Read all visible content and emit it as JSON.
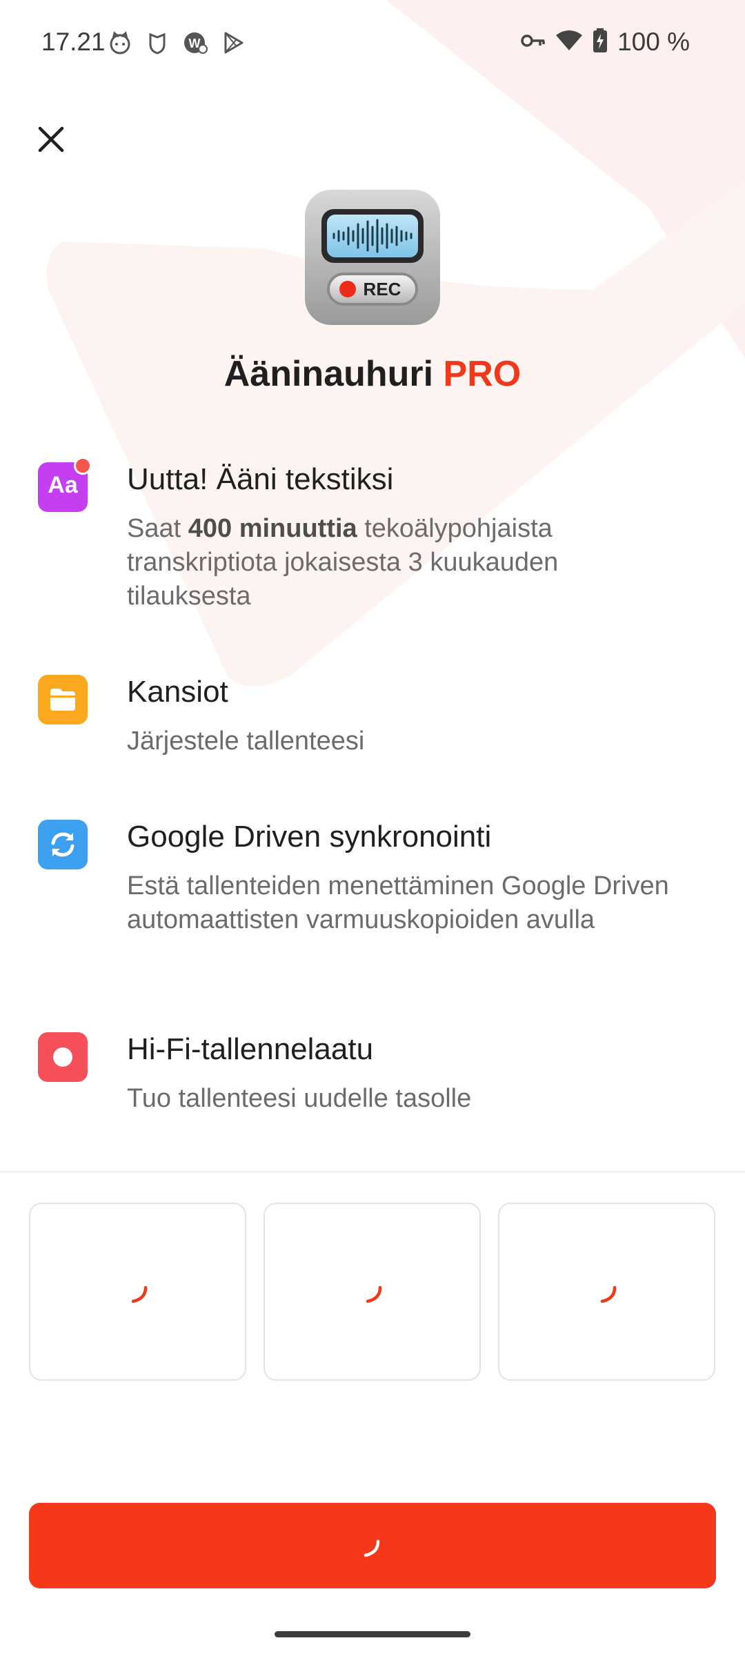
{
  "status_bar": {
    "time": "17.21",
    "battery": "100 %",
    "left_icons": [
      "cat-face-icon",
      "shield-cat-icon",
      "whatsapp-icon",
      "play-store-icon"
    ],
    "right_icons": [
      "key-icon",
      "wifi-icon",
      "battery-charging-icon"
    ]
  },
  "app": {
    "title_main": "Ääninauhuri",
    "title_accent": "PRO",
    "icon": "voice-recorder-app-icon",
    "icon_rec_label": "REC"
  },
  "features": [
    {
      "icon": "text-aa-icon",
      "icon_text": "Aa",
      "icon_color": "#c53ff0",
      "title": "Uutta! Ääni tekstiksi",
      "desc_prefix": "Saat ",
      "desc_bold": "400 minuuttia",
      "desc_suffix": " tekoälypohjaista transkriptiota jokaisesta 3 kuukauden tilauksesta"
    },
    {
      "icon": "folder-icon",
      "icon_color": "#fba81e",
      "title": "Kansiot",
      "desc": "Järjestele tallenteesi"
    },
    {
      "icon": "sync-icon",
      "icon_color": "#3d9ff0",
      "title": "Google Driven synkronointi",
      "desc": "Estä tallenteiden menettäminen Google Driven automaattisten varmuuskopioiden avulla"
    },
    {
      "icon": "record-icon",
      "icon_color": "#f5505a",
      "title": "Hi-Fi-tallennelaatu",
      "desc": "Tuo tallenteesi uudelle tasolle"
    }
  ],
  "plans": [
    {
      "state": "loading"
    },
    {
      "state": "loading"
    },
    {
      "state": "loading"
    }
  ],
  "cta": {
    "state": "loading",
    "color": "#f5381a"
  },
  "colors": {
    "accent": "#f0381a",
    "text": "#1f1f1f",
    "muted": "#6b6b6b"
  }
}
